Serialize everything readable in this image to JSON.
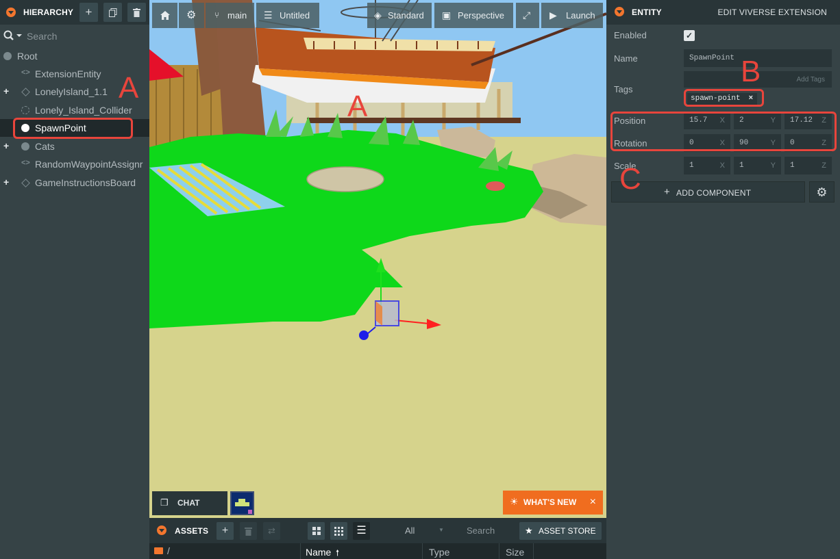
{
  "hierarchy": {
    "title": "HIERARCHY",
    "search_placeholder": "Search",
    "items": [
      {
        "label": "Root"
      },
      {
        "label": "ExtensionEntity"
      },
      {
        "label": "LonelyIsland_1.1"
      },
      {
        "label": "Lonely_Island_Collider"
      },
      {
        "label": "SpawnPoint"
      },
      {
        "label": "Cats"
      },
      {
        "label": "RandomWaypointAssignr"
      },
      {
        "label": "GameInstructionsBoard"
      }
    ]
  },
  "viewport": {
    "branch_label": "main",
    "scene_label": "Untitled",
    "render_mode_label": "Standard",
    "camera_label": "Perspective",
    "launch_label": "Launch",
    "chat_label": "CHAT",
    "whats_new_label": "WHAT'S NEW"
  },
  "assets": {
    "title": "ASSETS",
    "filter_value": "All",
    "search_placeholder": "Search",
    "store_label": "ASSET STORE",
    "path": "/",
    "columns": [
      "Name",
      "Type",
      "Size"
    ]
  },
  "inspector": {
    "title": "ENTITY",
    "extension_label": "EDIT VIVERSE EXTENSION",
    "enabled_label": "Enabled",
    "name_label": "Name",
    "name_value": "SpawnPoint",
    "tags_label": "Tags",
    "add_tags_placeholder": "Add Tags",
    "tag": "spawn-point",
    "position_label": "Position",
    "rotation_label": "Rotation",
    "scale_label": "Scale",
    "position": {
      "x": "15.77",
      "y": "2",
      "z": "17.12"
    },
    "rotation": {
      "x": "0",
      "y": "90",
      "z": "0"
    },
    "scale": {
      "x": "1",
      "y": "1",
      "z": "1"
    },
    "axes": {
      "x": "X",
      "y": "Y",
      "z": "Z"
    },
    "add_component_label": "ADD COMPONENT"
  },
  "annotations": {
    "a": "A",
    "b": "B",
    "c": "C"
  },
  "colors": {
    "accent": "#f3762e",
    "highlight": "#e8453c",
    "panel": "#364346",
    "header": "#293538"
  }
}
